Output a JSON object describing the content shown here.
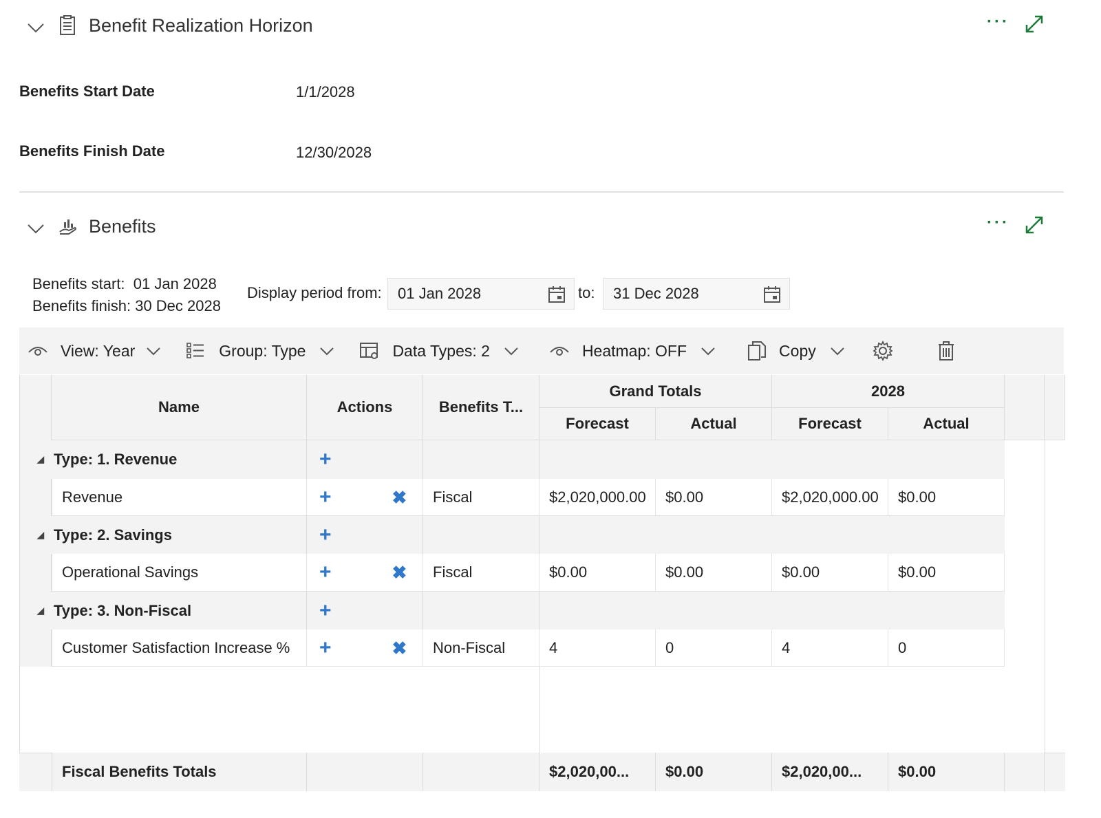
{
  "section1": {
    "title": "Benefit Realization Horizon",
    "more": "···",
    "fields": [
      {
        "label": "Benefits Start Date",
        "value": "1/1/2028"
      },
      {
        "label": "Benefits Finish Date",
        "value": "12/30/2028"
      }
    ]
  },
  "section2": {
    "title": "Benefits",
    "more": "···",
    "info": {
      "start_label": "Benefits start:",
      "start_value": "01 Jan 2028",
      "finish_label": "Benefits finish:",
      "finish_value": "30 Dec 2028"
    },
    "period": {
      "from_label": "Display period from:",
      "from_value": "01 Jan 2028",
      "to_label": "to:",
      "to_value": "31 Dec 2028"
    }
  },
  "toolbar": {
    "view": "View: Year",
    "group": "Group: Type",
    "data_types": "Data Types: 2",
    "heatmap": "Heatmap: OFF",
    "copy": "Copy"
  },
  "grid": {
    "headers": {
      "name": "Name",
      "actions": "Actions",
      "benefits_type": "Benefits T...",
      "grand_totals": "Grand Totals",
      "year": "2028",
      "forecast": "Forecast",
      "actual": "Actual"
    },
    "groups": [
      {
        "label": "Type: 1. Revenue",
        "row": {
          "name": "Revenue",
          "type": "Fiscal",
          "gt_forecast": "$2,020,000.00",
          "gt_actual": "$0.00",
          "y_forecast": "$2,020,000.00",
          "y_actual": "$0.00"
        }
      },
      {
        "label": "Type: 2. Savings",
        "row": {
          "name": "Operational Savings",
          "type": "Fiscal",
          "gt_forecast": "$0.00",
          "gt_actual": "$0.00",
          "y_forecast": "$0.00",
          "y_actual": "$0.00"
        }
      },
      {
        "label": "Type: 3. Non-Fiscal",
        "row": {
          "name": "Customer Satisfaction Increase %",
          "type": "Non-Fiscal",
          "gt_forecast": "4",
          "gt_actual": "0",
          "y_forecast": "4",
          "y_actual": "0"
        }
      }
    ],
    "totals": {
      "label": "Fiscal Benefits Totals",
      "gt_forecast": "$2,020,00...",
      "gt_actual": "$0.00",
      "y_forecast": "$2,020,00...",
      "y_actual": "$0.00"
    }
  },
  "glyphs": {
    "plus": "+",
    "x": "✖",
    "collapse": "◢"
  }
}
